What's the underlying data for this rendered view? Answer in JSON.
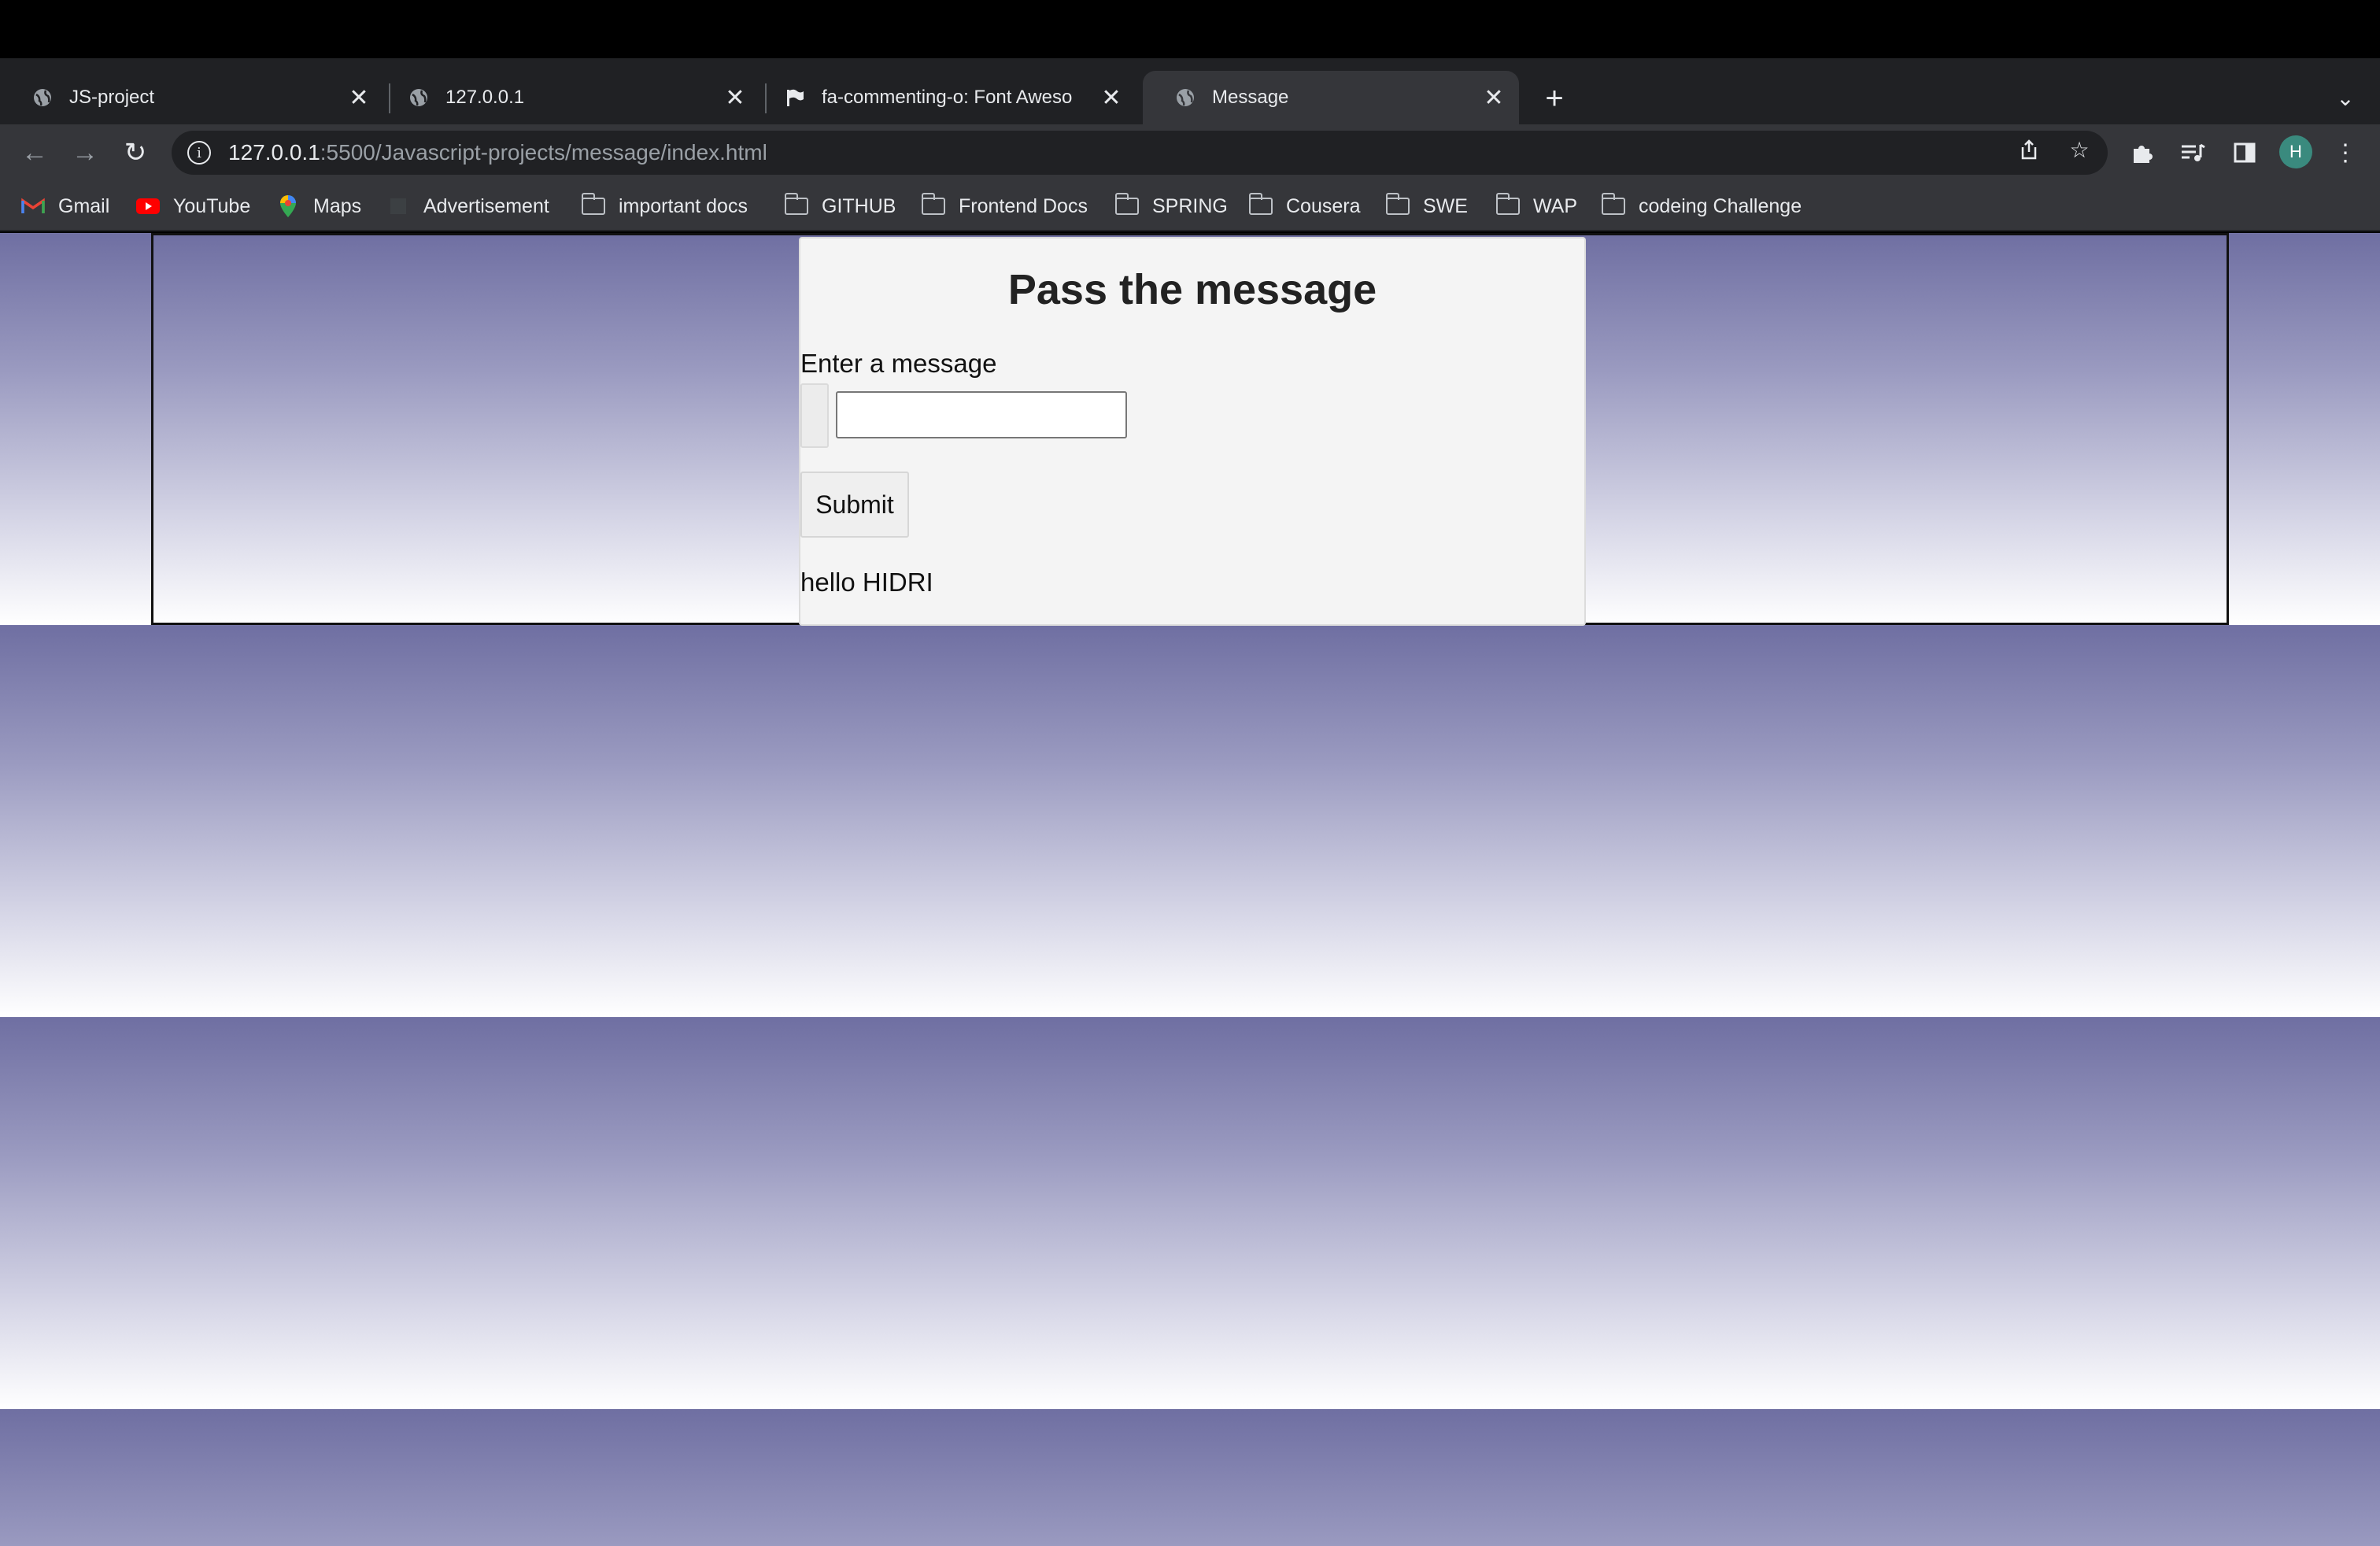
{
  "tabs": [
    {
      "title": "JS-project",
      "icon": "globe-icon",
      "active": false
    },
    {
      "title": "127.0.0.1",
      "icon": "globe-icon",
      "active": false
    },
    {
      "title": "fa-commenting-o: Font Aweso",
      "icon": "flag-icon",
      "active": false
    },
    {
      "title": "Message",
      "icon": "globe-icon",
      "active": true
    }
  ],
  "address_bar": {
    "host": "127.0.0.1",
    "path": ":5500/Javascript-projects/message/index.html"
  },
  "profile": {
    "initial": "H",
    "color": "#3a8a7e"
  },
  "bookmarks": [
    {
      "label": "Gmail",
      "icon": "gmail-icon"
    },
    {
      "label": "YouTube",
      "icon": "youtube-icon"
    },
    {
      "label": "Maps",
      "icon": "maps-icon"
    },
    {
      "label": "Advertisement",
      "icon": "page-icon"
    },
    {
      "label": "important docs",
      "icon": "folder-icon"
    },
    {
      "label": "GITHUB",
      "icon": "folder-icon"
    },
    {
      "label": "Frontend Docs",
      "icon": "folder-icon"
    },
    {
      "label": "SPRING",
      "icon": "folder-icon"
    },
    {
      "label": "Cousera",
      "icon": "folder-icon"
    },
    {
      "label": "SWE",
      "icon": "folder-icon"
    },
    {
      "label": "WAP",
      "icon": "folder-icon"
    },
    {
      "label": "codeing Challenge",
      "icon": "folder-icon"
    }
  ],
  "page": {
    "heading": "Pass the message",
    "input_label": "Enter a message",
    "input_value": "",
    "submit_label": "Submit",
    "output_text": "hello HIDRI"
  },
  "colors": {
    "gradient_top": "#6f6fa2",
    "gradient_bottom": "#ffffff",
    "card_background": "#f4f4f4",
    "browser_dark": "#202124",
    "browser_toolbar": "#35363a"
  }
}
